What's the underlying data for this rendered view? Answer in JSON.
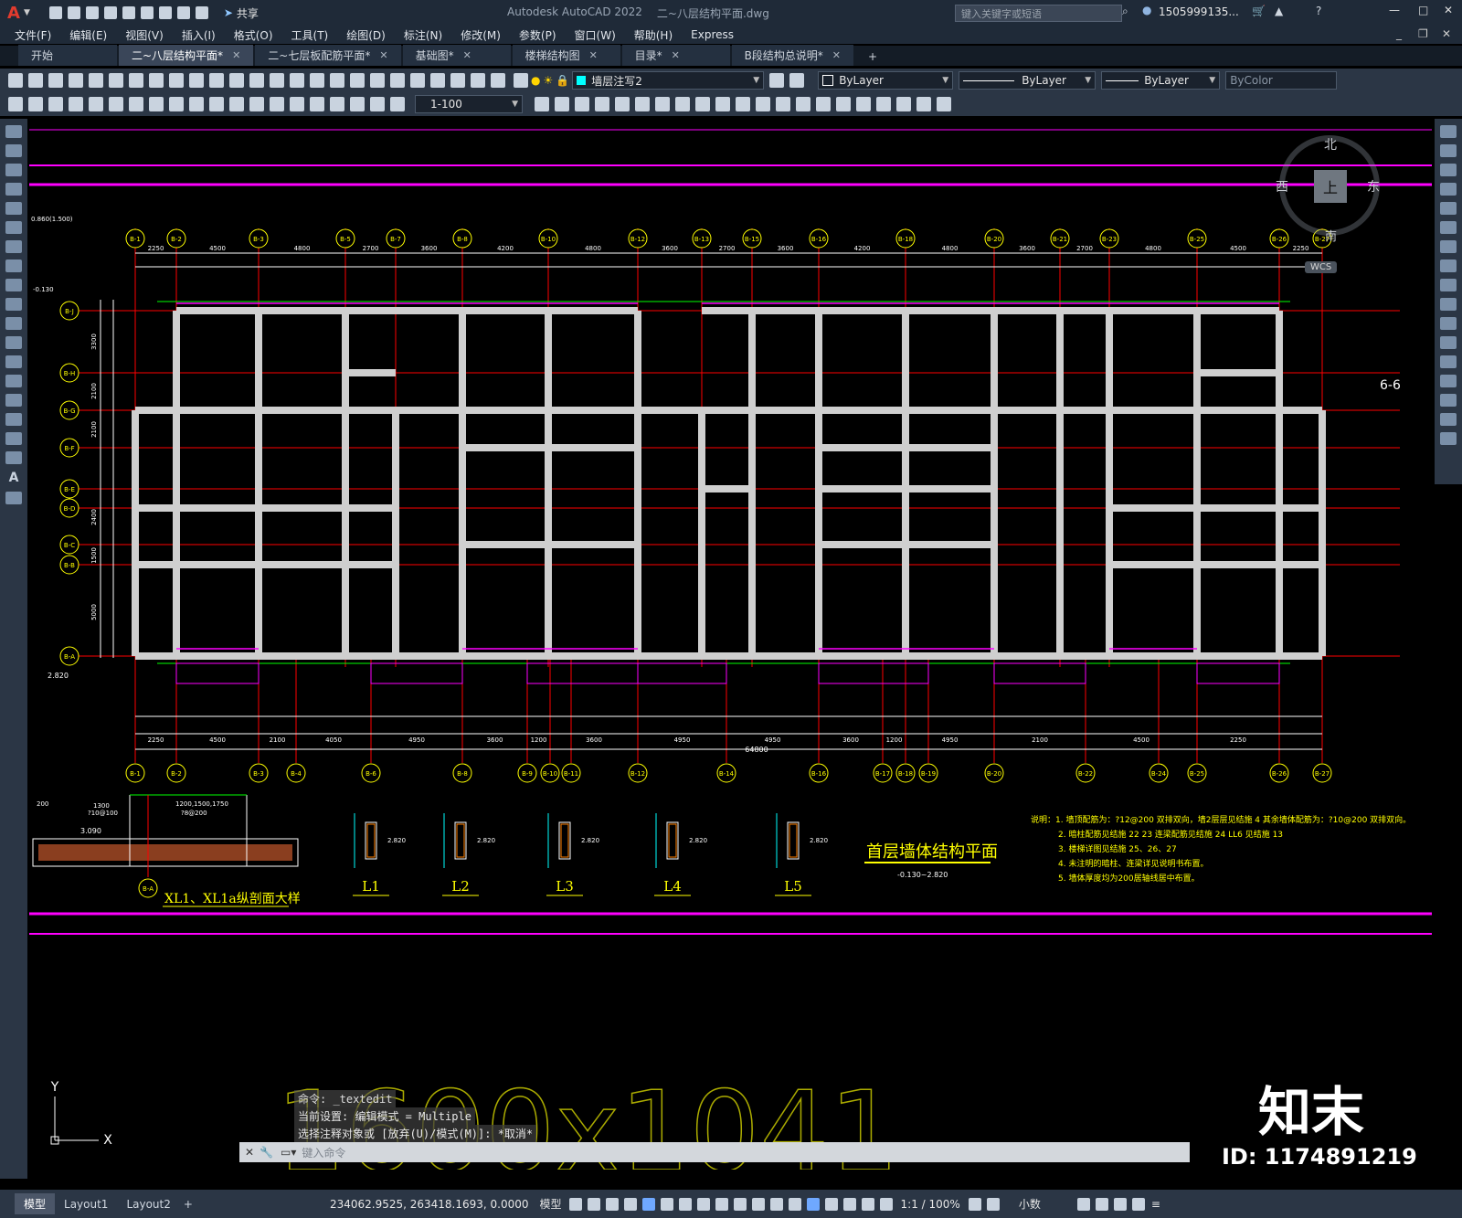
{
  "app": {
    "title": "Autodesk AutoCAD 2022",
    "document": "二~八层结构平面.dwg",
    "share": "共享",
    "search_placeholder": "键入关键字或短语",
    "user": "1505999135...",
    "logo": "A"
  },
  "menu": [
    "文件(F)",
    "编辑(E)",
    "视图(V)",
    "插入(I)",
    "格式(O)",
    "工具(T)",
    "绘图(D)",
    "标注(N)",
    "修改(M)",
    "参数(P)",
    "窗口(W)",
    "帮助(H)",
    "Express"
  ],
  "tabs": [
    {
      "label": "开始",
      "active": false,
      "close": false
    },
    {
      "label": "二~八层结构平面*",
      "active": true,
      "close": true
    },
    {
      "label": "二~七层板配筋平面*",
      "active": false,
      "close": true
    },
    {
      "label": "基础图*",
      "active": false,
      "close": true
    },
    {
      "label": "楼梯结构图",
      "active": false,
      "close": true
    },
    {
      "label": "目录*",
      "active": false,
      "close": true
    },
    {
      "label": "B段结构总说明*",
      "active": false,
      "close": true
    }
  ],
  "ribbon": {
    "layer": "墙层注写2",
    "color": "ByLayer",
    "linetype": "ByLayer",
    "lineweight": "ByLayer",
    "plotstyle": "ByColor",
    "scale": "1-100"
  },
  "viewcube": {
    "north": "北",
    "south": "南",
    "east": "东",
    "west": "西",
    "top": "上",
    "wcs": "WCS"
  },
  "drawing": {
    "axes_top": [
      "B-1",
      "B-2",
      "B-3",
      "B-5",
      "B-7",
      "B-8",
      "B-10",
      "B-12",
      "B-13",
      "B-15",
      "B-16",
      "B-18",
      "B-20",
      "B-21",
      "B-23",
      "B-25",
      "B-26",
      "B-27"
    ],
    "axes_bottom": [
      "B-1",
      "B-2",
      "B-3",
      "B-4",
      "B-6",
      "B-8",
      "B-9",
      "B-10",
      "B-11",
      "B-12",
      "B-14",
      "B-16",
      "B-17",
      "B-18",
      "B-19",
      "B-20",
      "B-22",
      "B-24",
      "B-25",
      "B-26",
      "B-27"
    ],
    "axes_left": [
      "B-J",
      "B-H",
      "B-G",
      "B-F",
      "B-E",
      "B-D",
      "B-C",
      "B-B",
      "B-A"
    ],
    "dims_top": [
      "2250",
      "4500",
      "4800",
      "2700",
      "3600",
      "4200",
      "4800",
      "3600",
      "2700",
      "3600",
      "4200",
      "4800",
      "3600",
      "2700",
      "4800",
      "4500",
      "2250"
    ],
    "dims_bottom": [
      "2250",
      "4500",
      "2100",
      "4050",
      "4950",
      "3600",
      "1200",
      "3600",
      "4950",
      "4950",
      "3600",
      "1200",
      "4950",
      "2100",
      "4500",
      "2250"
    ],
    "total_length": "64800",
    "dims_left": [
      "3300",
      "2100",
      "2100",
      "2400",
      "1500",
      "5000"
    ],
    "elev_top_left": "0.860(1.500)",
    "elev_mid_left": "-0.130",
    "elev_low_left": "2.820",
    "section_mark": "6-6",
    "beam_detail_title": "XL1、XL1a纵剖面大样",
    "beam_detail_elev": "3.090",
    "beam_detail_dims": [
      "1300",
      "200",
      "?10@100",
      "1200,1500,1750",
      "?8@200"
    ],
    "lintels": [
      "L1",
      "L2",
      "L3",
      "L4",
      "L5"
    ],
    "lintel_elev": "2.820",
    "plan_title": "首层墙体结构平面",
    "plan_elev": "-0.130~2.820",
    "notes": [
      "说明：1. 墙顶配筋为：?12@200 双排双向，墙2层层见结施 4  其余墙体配筋为：?10@200 双排双向。",
      "2. 暗柱配筋见结施 22 23  连梁配筋见结施 24  LL6 见结施 13",
      "3. 楼梯详图见结施 25、26、27",
      "4. 未注明的暗柱、连梁详见说明书布置。",
      "5. 墙体厚度均为200居轴线居中布置。"
    ]
  },
  "command": {
    "line1": "命令: _textedit",
    "line2": "当前设置: 编辑模式 = Multiple",
    "line3": "选择注释对象或 [放弃(U)/模式(M)]: *取消*",
    "placeholder": "键入命令"
  },
  "watermark": {
    "big": "1600x1041",
    "brand": "知末",
    "id": "ID: 1174891219"
  },
  "status": {
    "model_tab": "模型",
    "layout1": "Layout1",
    "layout2": "Layout2",
    "coords": "234062.9525, 263418.1693, 0.0000",
    "mode": "模型",
    "scale": "1:1 / 100%",
    "units": "小数"
  },
  "colors": {
    "bg": "#000000",
    "magenta": "#ff00ff",
    "red": "#ff0000",
    "green": "#00ff00",
    "wall": "#d8d8d8",
    "yellow": "#ffff00",
    "cyan": "#00ffff",
    "chrome": "#2b3645"
  }
}
